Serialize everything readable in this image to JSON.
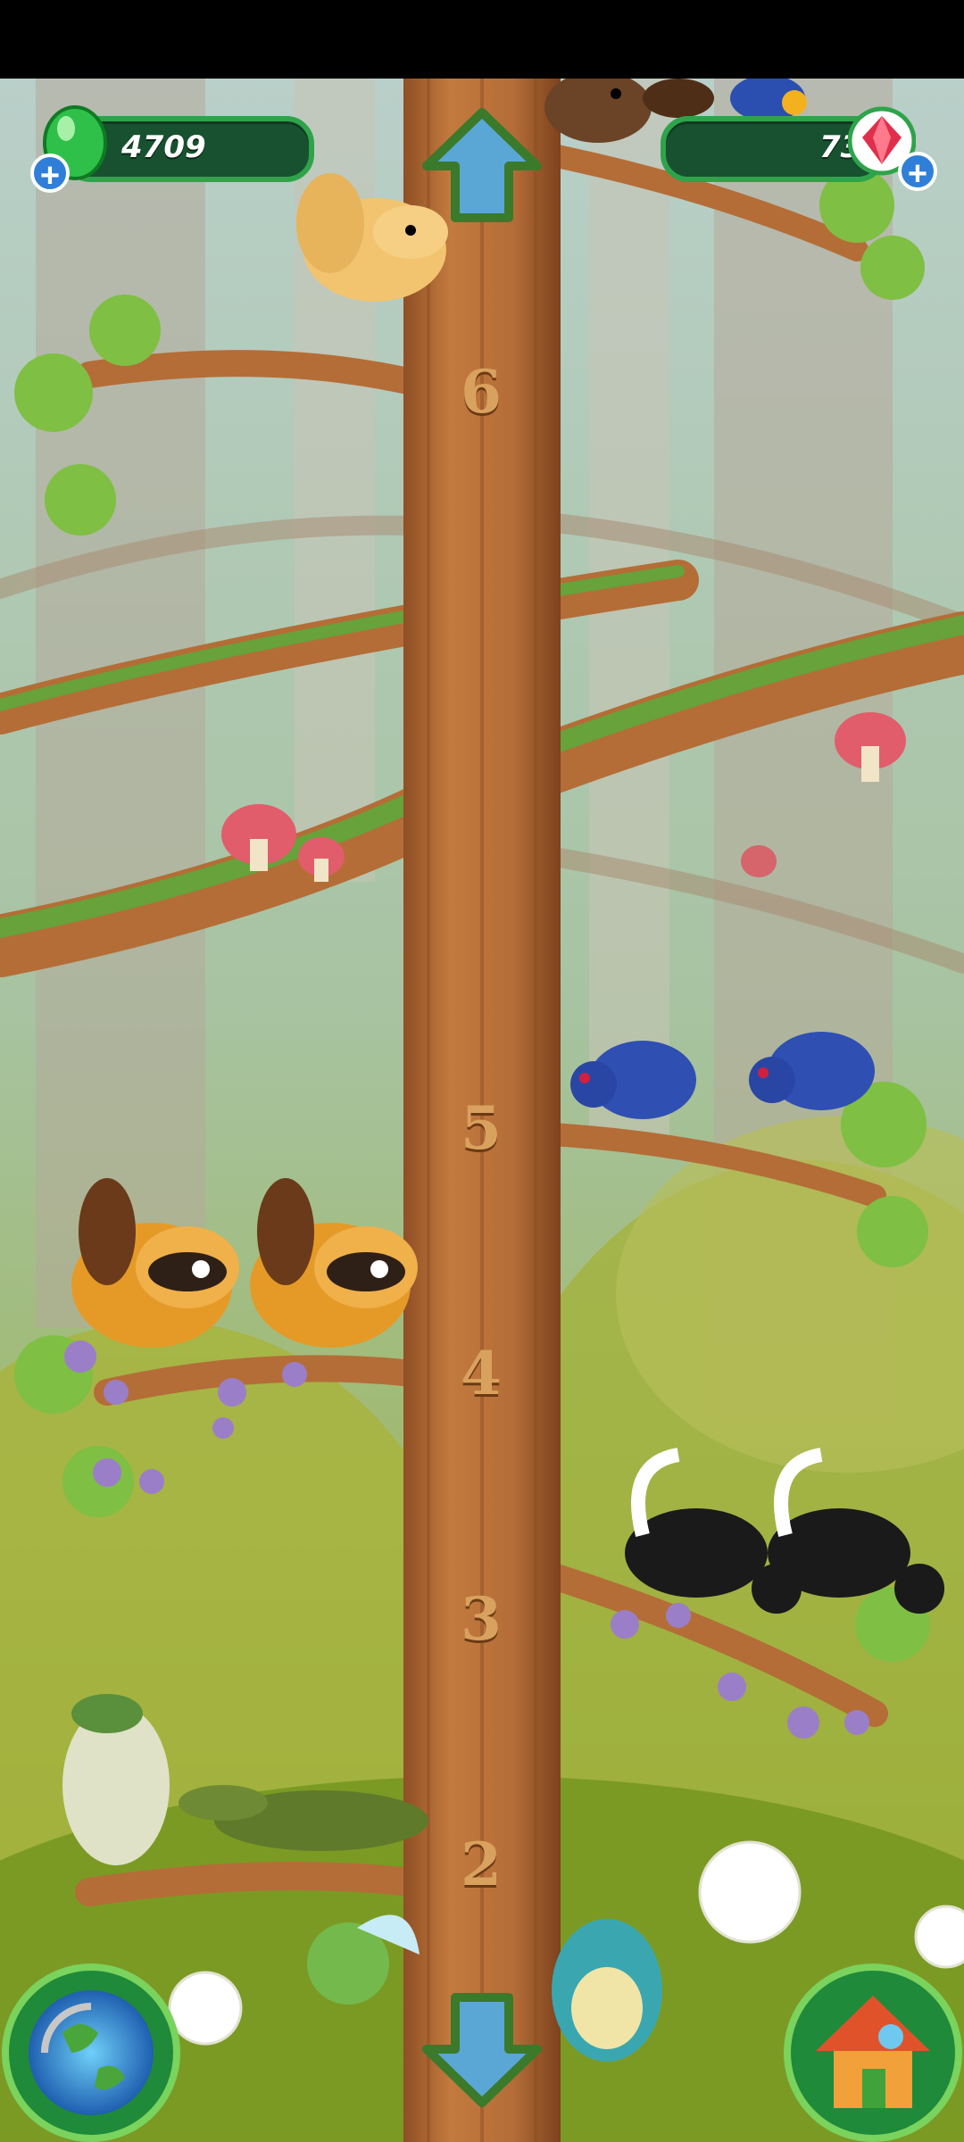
{
  "hud": {
    "gems_value": "4709",
    "crystals_value": "73",
    "gem_icon": "green-gem-icon",
    "crystal_icon": "red-crystal-icon",
    "plus_icon": "plus-icon"
  },
  "tree": {
    "floors": [
      "6",
      "5",
      "4",
      "3",
      "2"
    ]
  },
  "buttons": {
    "up": "up-arrow-icon",
    "down": "down-arrow-icon",
    "world_map": "globe-icon",
    "home": "house-icon"
  },
  "colors": {
    "hud_fill": "#17512f",
    "hud_border": "#2fa34a",
    "trunk": "#b06a36",
    "floor_text": "#d9a15e"
  }
}
